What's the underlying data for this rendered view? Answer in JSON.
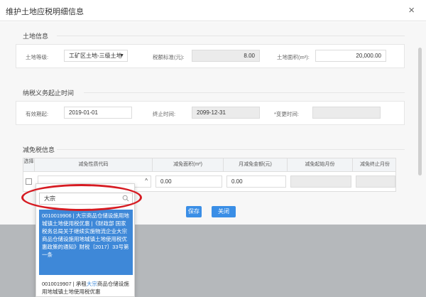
{
  "dialog": {
    "title": "维护土地应税明细信息",
    "close_icon": "close-icon",
    "close_glyph": "×"
  },
  "land_info": {
    "title": "土地信息",
    "grade_label": "土地等级:",
    "grade_value": "工矿区土地-三级土地",
    "tax_standard_label": "税额标准(元):",
    "tax_standard_value": "8.00",
    "area_label": "土地面积(m²):",
    "area_value": "20,000.00"
  },
  "tax_period": {
    "title": "纳税义务起止时间",
    "start_label": "有效期起:",
    "start_value": "2019-01-01",
    "end_label": "终止时间:",
    "end_value": "2099-12-31",
    "change_label": "*变更时间:",
    "change_value": ""
  },
  "relief": {
    "title": "减免税信息",
    "columns": [
      "选择",
      "减免性质代码",
      "减免面积(m²)",
      "月减免金额(元)",
      "减免起始月份",
      "减免终止月份"
    ],
    "row": {
      "code_value": "",
      "area_value": "0.00",
      "amount_value": "0.00",
      "start_month": "",
      "end_month": ""
    }
  },
  "buttons": {
    "save": "保存",
    "close": "关闭"
  },
  "dropdown": {
    "search_value": "大宗",
    "options": [
      {
        "pre": "0010019906 | ",
        "hl": "大宗",
        "post": "商品仓储设施用地城镇土地使用税优惠 |《财政部 国家税务总局关于继续实施物流企业大宗商品仓储设施用地城镇土地使用税优惠政策的通知》财税〔2017〕33号第一条"
      },
      {
        "pre": "0010019907 | 承租",
        "hl": "大宗",
        "post": "商品仓储设施用地城镇土地使用税优惠"
      }
    ]
  },
  "colors": {
    "primary": "#3a8ee6",
    "selected_item": "#3e88d8",
    "annotation": "#d61b22"
  }
}
